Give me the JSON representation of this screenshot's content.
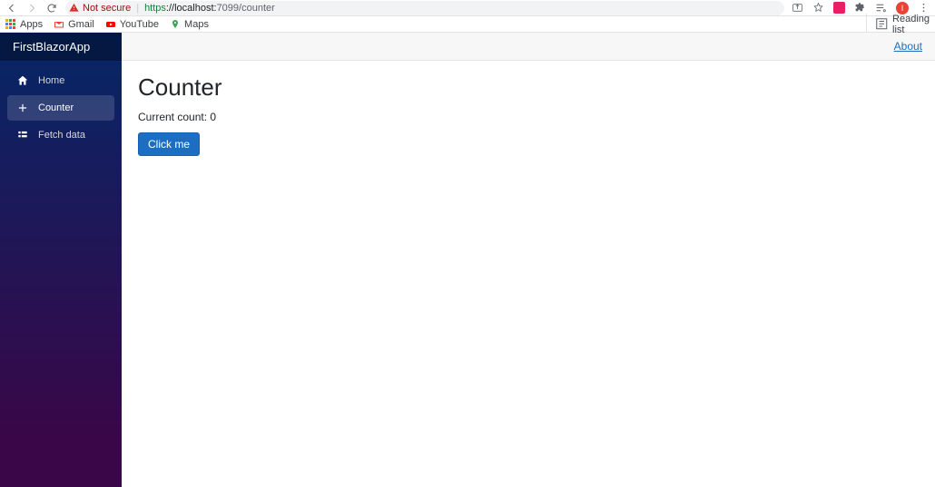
{
  "browser": {
    "security_label": "Not secure",
    "url_prefix": "https",
    "url_host": "://localhost:",
    "url_port": "7099",
    "url_path": "/counter",
    "reading_list": "Reading list",
    "bookmarks": {
      "apps": "Apps",
      "gmail": "Gmail",
      "youtube": "YouTube",
      "maps": "Maps"
    }
  },
  "sidebar": {
    "brand": "FirstBlazorApp",
    "items": [
      {
        "label": "Home"
      },
      {
        "label": "Counter"
      },
      {
        "label": "Fetch data"
      }
    ]
  },
  "header": {
    "about": "About"
  },
  "page": {
    "title": "Counter",
    "count_label": "Current count:",
    "count_value": "0",
    "button_label": "Click me"
  }
}
